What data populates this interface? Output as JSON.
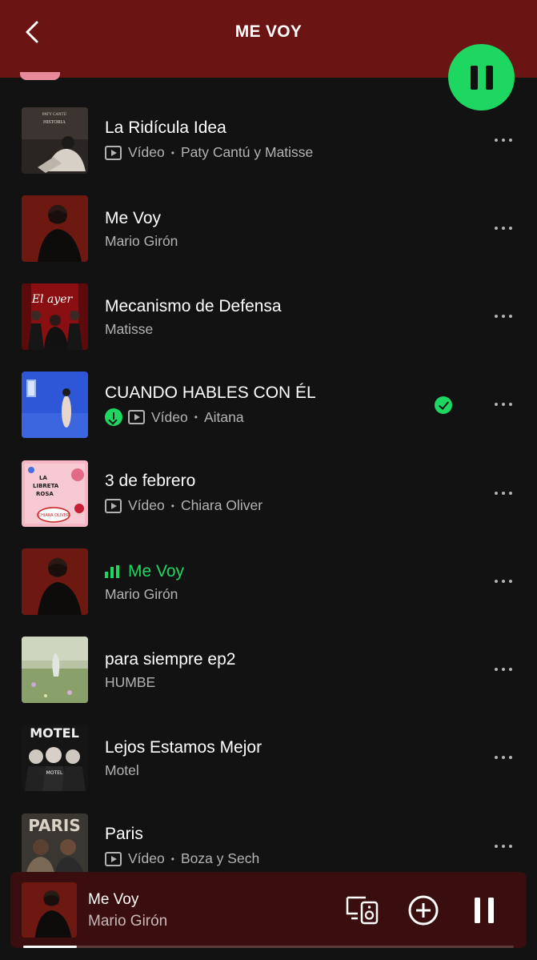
{
  "header": {
    "title": "ME VOY"
  },
  "tracks": [
    {
      "title": "La Ridícula Idea",
      "video_label": "Vídeo",
      "artist": "Paty Cantú y Matisse",
      "is_video": true
    },
    {
      "title": "Me Voy",
      "artist": "Mario Girón"
    },
    {
      "title": "Mecanismo de Defensa",
      "artist": "Matisse"
    },
    {
      "title": "CUANDO HABLES CON ÉL",
      "video_label": "Vídeo",
      "artist": "Aitana",
      "is_video": true,
      "downloaded": true,
      "liked": true
    },
    {
      "title": "3 de febrero",
      "video_label": "Vídeo",
      "artist": "Chiara Oliver",
      "is_video": true
    },
    {
      "title": "Me Voy",
      "artist": "Mario Girón",
      "now_playing": true
    },
    {
      "title": "para siempre ep2",
      "artist": "HUMBE"
    },
    {
      "title": "Lejos Estamos Mejor",
      "artist": "Motel"
    },
    {
      "title": "Paris",
      "video_label": "Vídeo",
      "artist": "Boza y Sech",
      "is_video": true
    }
  ],
  "cover_text": {
    "track0_line1": "PATY CANTÚ",
    "track0_line2": "HISTORIA",
    "track2_script": "El ayer",
    "track4_line1": "LA",
    "track4_line2": "LIBRETA",
    "track4_line3": "ROSA",
    "track4_line4": "CHIARA OLIVER",
    "track7_top": "MOTEL",
    "track7_mid": "MOTEL",
    "track8_top": "PARIS"
  },
  "mini_player": {
    "title": "Me Voy",
    "artist": "Mario Girón",
    "progress": 0.11
  },
  "colors": {
    "accent": "#1ed760",
    "header_bg": "#6b1414",
    "mini_bg": "#3a0e0e",
    "bg": "#121212"
  },
  "icons": [
    "chevron-left-icon",
    "pause-icon",
    "video-icon",
    "download-icon",
    "check-icon",
    "more-icon",
    "devices-icon",
    "add-icon",
    "equalizer-icon"
  ]
}
